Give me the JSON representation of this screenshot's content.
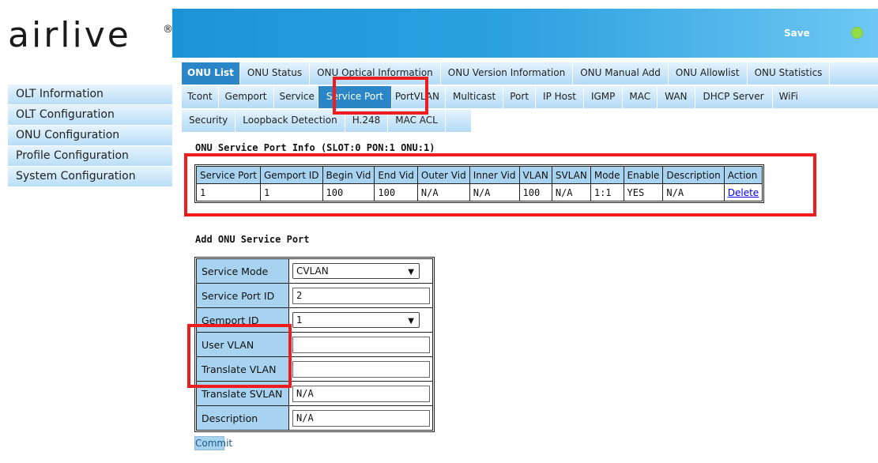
{
  "brand": {
    "logo_text": "airlive",
    "reg_mark": "®"
  },
  "header": {
    "save_label": "Save",
    "status_color": "#95dc4b"
  },
  "sidebar": {
    "items": [
      {
        "label": "OLT Information"
      },
      {
        "label": "OLT Configuration"
      },
      {
        "label": "ONU Configuration"
      },
      {
        "label": "Profile Configuration"
      },
      {
        "label": "System Configuration"
      }
    ]
  },
  "tabs": {
    "row1": [
      "ONU List",
      "ONU Status",
      "ONU Optical Information",
      "ONU Version Information",
      "ONU Manual Add",
      "ONU Allowlist",
      "ONU Statistics"
    ],
    "row2": [
      "Tcont",
      "Gemport",
      "Service",
      "Service Port",
      "PortVLAN",
      "Multicast",
      "Port",
      "IP Host",
      "IGMP",
      "MAC",
      "WAN",
      "DHCP Server",
      "WiFi"
    ],
    "row3": [
      "Security",
      "Loopback Detection",
      "H.248",
      "MAC ACL"
    ]
  },
  "info": {
    "title": "ONU Service Port Info (SLOT:0 PON:1 ONU:1)",
    "columns": [
      "Service Port",
      "Gemport ID",
      "Begin Vid",
      "End Vid",
      "Outer Vid",
      "Inner Vid",
      "VLAN",
      "SVLAN",
      "Mode",
      "Enable",
      "Description",
      "Action"
    ],
    "rows": [
      [
        "1",
        "1",
        "100",
        "100",
        "N/A",
        "N/A",
        "100",
        "N/A",
        "1:1",
        "YES",
        "N/A",
        "Delete"
      ]
    ]
  },
  "form": {
    "title": "Add ONU Service Port",
    "service_mode_label": "Service Mode",
    "service_mode_value": "CVLAN",
    "service_port_id_label": "Service Port ID",
    "service_port_id_value": "2",
    "gemport_id_label": "Gemport ID",
    "gemport_id_value": "1",
    "user_vlan_label": "User VLAN",
    "user_vlan_value": "",
    "translate_vlan_label": "Translate VLAN",
    "translate_vlan_value": "",
    "translate_svlan_label": "Translate SVLAN",
    "translate_svlan_value": "N/A",
    "description_label": "Description",
    "description_value": "N/A",
    "commit_label": "Commit"
  },
  "colors": {
    "accent": "#2a86c6",
    "header": "#1b93d6",
    "highlight": "#ee1c1c",
    "cell_header": "#a7d3f0"
  }
}
